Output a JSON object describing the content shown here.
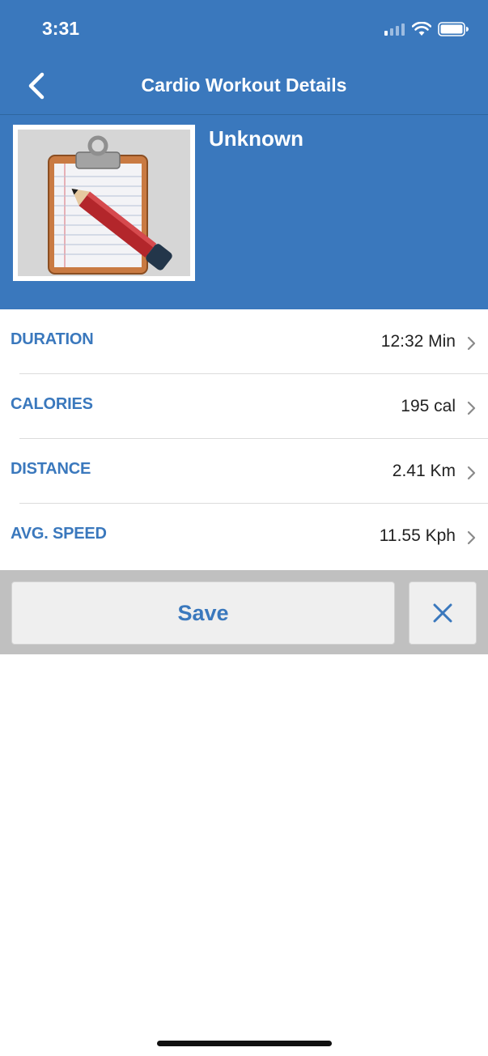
{
  "status_bar": {
    "time": "3:31"
  },
  "navbar": {
    "title": "Cardio Workout Details"
  },
  "workout": {
    "name": "Unknown"
  },
  "rows": [
    {
      "label": "DURATION",
      "value": "12:32 Min"
    },
    {
      "label": "CALORIES",
      "value": "195 cal"
    },
    {
      "label": "DISTANCE",
      "value": "2.41 Km"
    },
    {
      "label": "AVG. SPEED",
      "value": "11.55 Kph"
    }
  ],
  "actions": {
    "save_label": "Save"
  },
  "colors": {
    "primary": "#3a78bd",
    "action_bar": "#c0c0c0",
    "button_bg": "#efefef"
  },
  "icons": {
    "back": "chevron-left-icon",
    "row": "chevron-right-icon",
    "close": "close-icon",
    "image": "clipboard-pencil-icon"
  }
}
